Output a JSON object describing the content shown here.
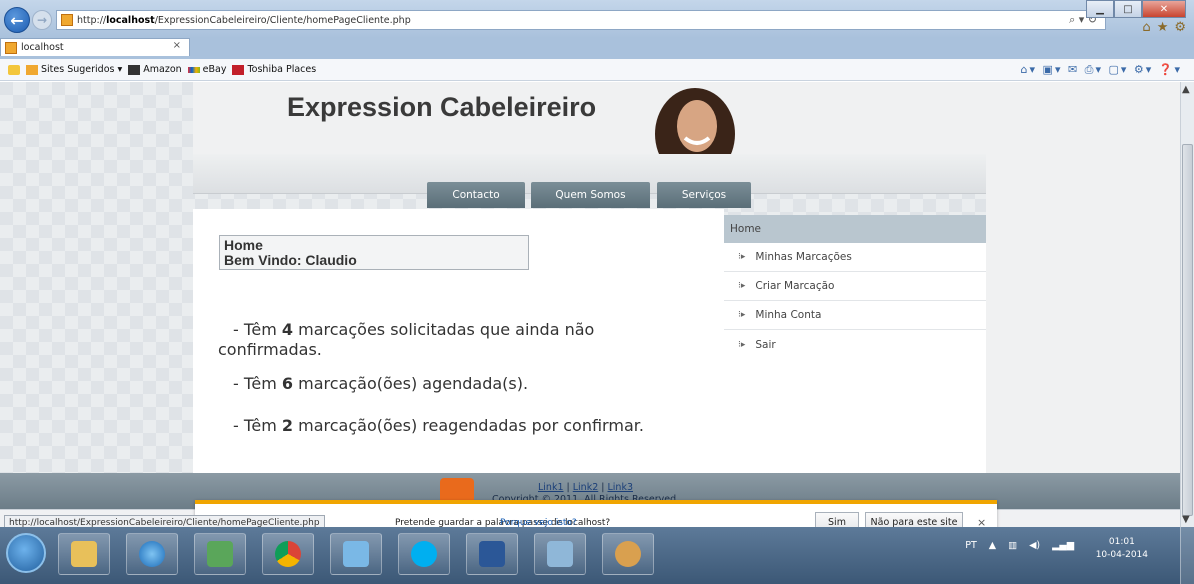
{
  "browser": {
    "url_prefix": "http://",
    "url_host": "localhost",
    "url_path": "/ExpressionCabeleireiro/Cliente/homePageCliente.php",
    "tab_title": "localhost",
    "tab_close": "×",
    "favorites": [
      "Sites Sugeridos ▾",
      "Amazon",
      "eBay",
      "Toshiba Places"
    ],
    "address_icons": "⌕ ▾ ↻",
    "right_icons": [
      "⌂",
      "★",
      "⚙"
    ]
  },
  "site": {
    "title": "Expression Cabeleireiro",
    "nav": [
      "Contacto",
      "Quem Somos",
      "Serviços"
    ],
    "welcome_heading": "Home",
    "welcome_user": "Bem Vindo: Claudio",
    "messages": [
      {
        "prefix": "- Têm ",
        "count": "4",
        "suffix": " marcações solicitadas que ainda não",
        "line2": "confirmadas."
      },
      {
        "prefix": "- Têm ",
        "count": "6",
        "suffix": " marcação(ões) agendada(s)."
      },
      {
        "prefix": "- Têm ",
        "count": "2",
        "suffix": " marcação(ões) reagendadas por confirmar."
      }
    ],
    "menu_home": "Home",
    "menu_items": [
      "Minhas Marcações",
      "Criar Marcação",
      "Minha Conta",
      "Sair"
    ],
    "footer_links": [
      "Link1",
      "Link2",
      "Link3"
    ],
    "copyright": "Copyright © 2011. All Rights Reserved."
  },
  "notification": {
    "text": "Pretende guardar a palavra-passe de localhost?",
    "link": "Porque vejo isto?",
    "yes_button": "Sim",
    "no_button": "Não para este site",
    "close": "×"
  },
  "status_url": "http://localhost/ExpressionCabeleireiro/Cliente/homePageCliente.php",
  "taskbar": {
    "lang": "PT",
    "time": "01:01",
    "date": "10-04-2014"
  },
  "colors": {
    "nav_tab": "#6a7d87",
    "menu_home_bg": "#b9c6cf",
    "notif_accent": "#f0a500",
    "rss": "#e96a1c"
  }
}
